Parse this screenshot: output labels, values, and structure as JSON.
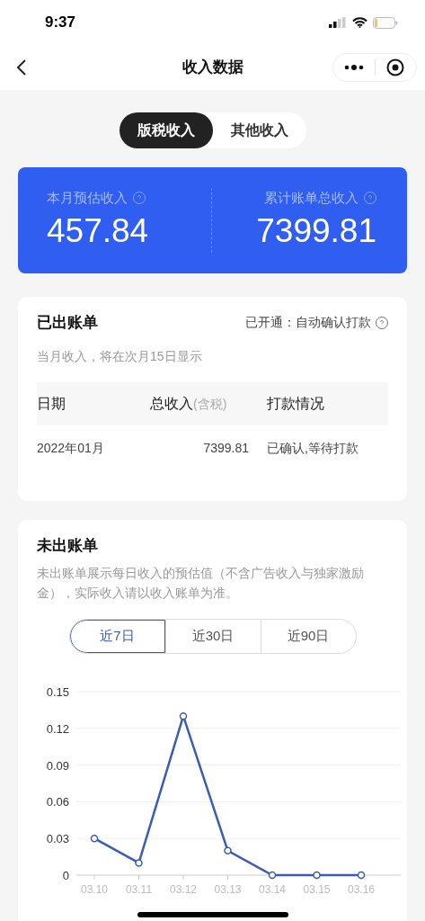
{
  "status_bar": {
    "time": "9:37"
  },
  "nav": {
    "title": "收入数据"
  },
  "tabs": [
    {
      "label": "版税收入",
      "selected": true
    },
    {
      "label": "其他收入",
      "selected": false
    }
  ],
  "summary": [
    {
      "label": "本月预估收入",
      "value": "457.84"
    },
    {
      "label": "累计账单总收入",
      "value": "7399.81"
    }
  ],
  "billed": {
    "title": "已出账单",
    "status": "已开通：自动确认打款",
    "note": "当月收入，将在次月15日显示",
    "columns": [
      {
        "label": "日期"
      },
      {
        "label": "总收入",
        "suffix": "(含税)"
      },
      {
        "label": "打款情况"
      }
    ],
    "rows": [
      [
        "2022年01月",
        "7399.81",
        "已确认,等待打款"
      ]
    ]
  },
  "unbilled": {
    "title": "未出账单",
    "description": "未出账单展示每日收入的预估值（不含广告收入与独家激励金），实际收入请以收入账单为准。",
    "ranges": [
      {
        "label": "近7日",
        "selected": true
      },
      {
        "label": "近30日",
        "selected": false
      },
      {
        "label": "近90日",
        "selected": false
      }
    ],
    "chart_data": {
      "type": "line",
      "categories": [
        "03.10",
        "03.11",
        "03.12",
        "03.13",
        "03.14",
        "03.15",
        "03.16"
      ],
      "series": [
        {
          "color": "#3b5bb5",
          "marker": true,
          "values": [
            0.03,
            0.01,
            0.13,
            0.02,
            0,
            0,
            0
          ]
        }
      ],
      "grid": true,
      "ylim": [
        0,
        0.15
      ],
      "yticks": [
        0,
        0.03,
        0.06,
        0.09,
        0.12,
        0.15
      ]
    }
  }
}
